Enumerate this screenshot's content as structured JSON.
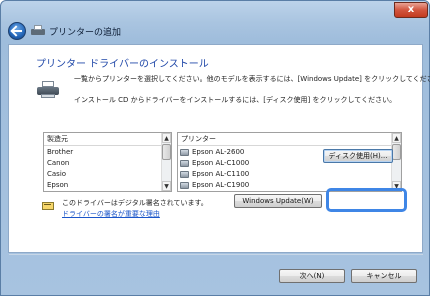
{
  "window": {
    "title": "プリンターの追加",
    "close_label": "x"
  },
  "content": {
    "heading": "プリンター ドライバーのインストール",
    "instruction_1": "一覧からプリンターを選択してください。他のモデルを表示するには、[Windows Update] をクリックしてください。",
    "instruction_2": "インストール CD からドライバーをインストールするには、[ディスク使用] をクリックしてください。"
  },
  "manufacturer_list": {
    "header": "製造元",
    "items": [
      "Brother",
      "Canon",
      "Casio",
      "Epson"
    ]
  },
  "printer_list": {
    "header": "プリンター",
    "items": [
      "Epson AL-2600",
      "Epson AL-C1000",
      "Epson AL-C1100",
      "Epson AL-C1900"
    ]
  },
  "signature": {
    "text": "このドライバーはデジタル署名されています。",
    "link": "ドライバーの署名が重要な理由"
  },
  "buttons": {
    "windows_update": "Windows Update(W)",
    "have_disk": "ディスク使用(H)...",
    "next": "次へ(N)",
    "cancel": "キャンセル"
  },
  "scrollbar": {
    "up": "▲",
    "down": "▼"
  },
  "icons": [
    "back-arrow-icon",
    "printer-icon",
    "signed-driver-icon"
  ],
  "colors": {
    "heading": "#1f47a8",
    "focus_ring": "#3f86e6",
    "close_button": "#c23a20",
    "link": "#1a55c9"
  }
}
